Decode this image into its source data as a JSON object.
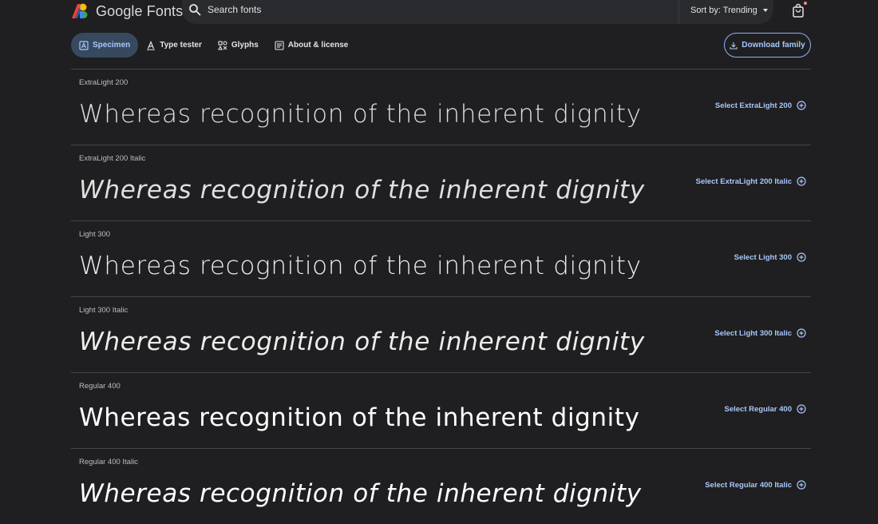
{
  "header": {
    "logo_text": "Google Fonts",
    "search_placeholder": "Search fonts",
    "sort_label": "Sort by: Trending"
  },
  "tabs": [
    {
      "label": "Specimen",
      "icon": "specimen-icon",
      "active": true
    },
    {
      "label": "Type tester",
      "icon": "type-tester-icon",
      "active": false
    },
    {
      "label": "Glyphs",
      "icon": "glyphs-icon",
      "active": false
    },
    {
      "label": "About & license",
      "icon": "about-icon",
      "active": false
    }
  ],
  "download_label": "Download family",
  "sample_text": "Whereas recognition of the inherent dignity",
  "styles": [
    {
      "label": "ExtraLight 200",
      "select": "Select ExtraLight 200"
    },
    {
      "label": "ExtraLight 200 Italic",
      "select": "Select ExtraLight 200 Italic"
    },
    {
      "label": "Light 300",
      "select": "Select Light 300"
    },
    {
      "label": "Light 300 Italic",
      "select": "Select Light 300 Italic"
    },
    {
      "label": "Regular 400",
      "select": "Select Regular 400"
    },
    {
      "label": "Regular 400 Italic",
      "select": "Select Regular 400 Italic"
    }
  ],
  "colors": {
    "background": "#1f1f21",
    "accent": "#a8c7fa",
    "active_tab_bg": "#37495f",
    "notification_dot": "#f28b82"
  }
}
